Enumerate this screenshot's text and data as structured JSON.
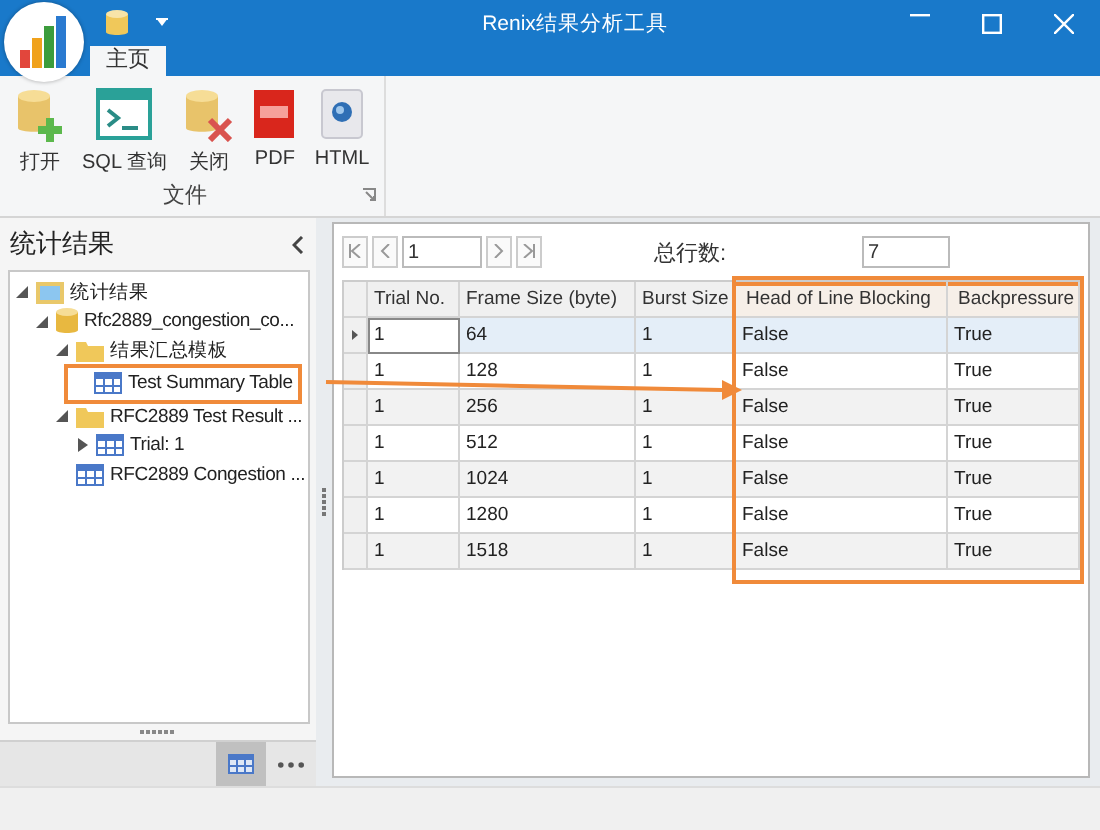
{
  "window": {
    "title": "Renix结果分析工具"
  },
  "ribbon": {
    "tabs": [
      {
        "label": "主页",
        "selected": true
      }
    ],
    "groups": [
      {
        "label": "文件",
        "buttons": [
          {
            "label": "打开",
            "kind": "open"
          },
          {
            "label": "SQL 查询",
            "kind": "sql"
          },
          {
            "label": "关闭",
            "kind": "close"
          },
          {
            "label": "PDF",
            "kind": "pdf"
          },
          {
            "label": "HTML",
            "kind": "html"
          }
        ]
      }
    ]
  },
  "sidebar": {
    "title": "统计结果",
    "tree": [
      {
        "label": "统计结果",
        "kind": "root",
        "expanded": true,
        "highlighted": false,
        "children": [
          {
            "label": "Rfc2889_congestion_co...",
            "kind": "db",
            "expanded": true,
            "highlighted": false,
            "children": [
              {
                "label": "结果汇总模板",
                "kind": "folder",
                "expanded": true,
                "highlighted": false,
                "children": [
                  {
                    "label": "Test Summary Table",
                    "kind": "table",
                    "highlighted": true
                  }
                ]
              },
              {
                "label": "RFC2889 Test Result ...",
                "kind": "folder",
                "expanded": true,
                "highlighted": false,
                "children": [
                  {
                    "label": "Trial: 1",
                    "kind": "table",
                    "expanded": false,
                    "highlighted": false
                  }
                ]
              },
              {
                "label": "RFC2889 Congestion ...",
                "kind": "table",
                "highlighted": false
              }
            ]
          }
        ]
      }
    ],
    "views": [
      {
        "kind": "table",
        "selected": true
      },
      {
        "kind": "more",
        "selected": false
      }
    ]
  },
  "navigator": {
    "page": "1",
    "total_label": "总行数:",
    "total": "7"
  },
  "table": {
    "columns": [
      {
        "label": "Trial No.",
        "highlighted": false
      },
      {
        "label": "Frame Size (byte)",
        "highlighted": false
      },
      {
        "label": "Burst Size",
        "highlighted": false
      },
      {
        "label": "Head of Line Blocking",
        "highlighted": true
      },
      {
        "label": "Backpressure",
        "highlighted": true
      }
    ],
    "rows": [
      {
        "selected": true,
        "cells": [
          "1",
          "64",
          "1",
          "False",
          "True"
        ]
      },
      {
        "selected": false,
        "cells": [
          "1",
          "128",
          "1",
          "False",
          "True"
        ]
      },
      {
        "selected": false,
        "cells": [
          "1",
          "256",
          "1",
          "False",
          "True"
        ]
      },
      {
        "selected": false,
        "cells": [
          "1",
          "512",
          "1",
          "False",
          "True"
        ]
      },
      {
        "selected": false,
        "cells": [
          "1",
          "1024",
          "1",
          "False",
          "True"
        ]
      },
      {
        "selected": false,
        "cells": [
          "1",
          "1280",
          "1",
          "False",
          "True"
        ]
      },
      {
        "selected": false,
        "cells": [
          "1",
          "1518",
          "1",
          "False",
          "True"
        ]
      }
    ]
  }
}
